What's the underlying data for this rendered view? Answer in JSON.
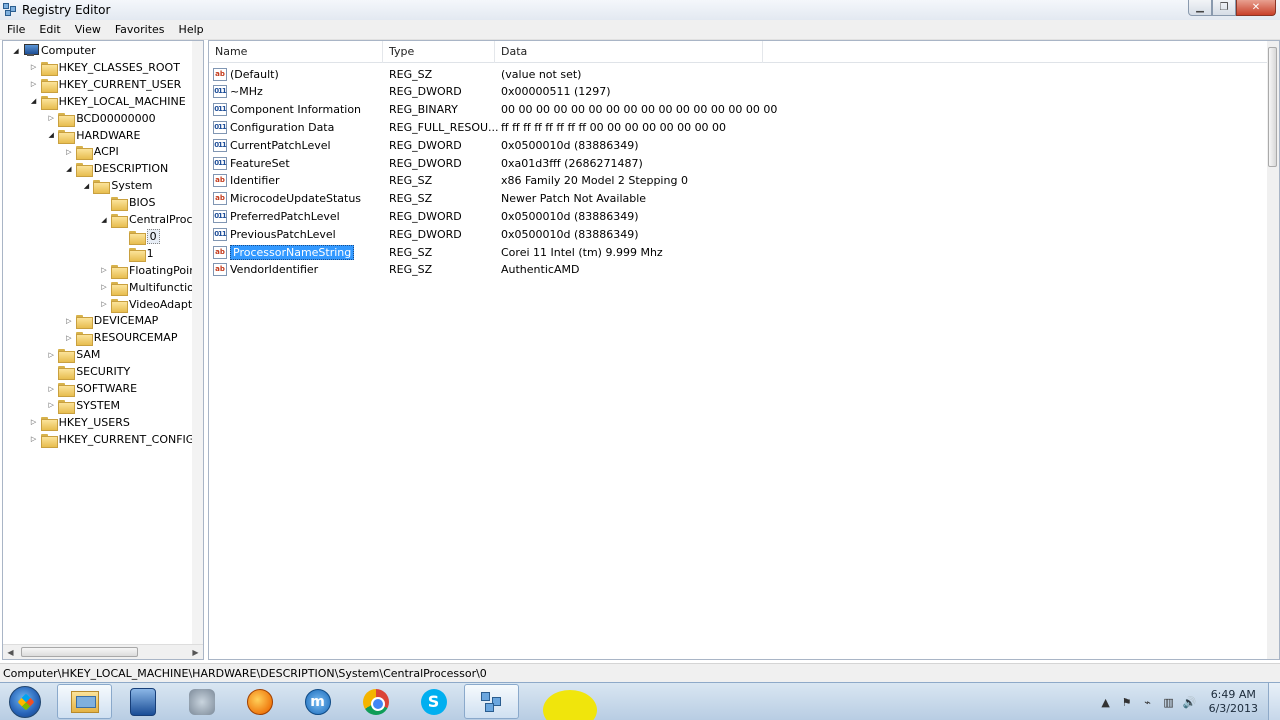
{
  "window": {
    "title": "Registry Editor"
  },
  "window_buttons": {
    "minimize": "▁",
    "maximize": "❐",
    "close": "✕"
  },
  "menu": [
    "File",
    "Edit",
    "View",
    "Favorites",
    "Help"
  ],
  "tree": [
    {
      "label": "Computer",
      "depth": 0,
      "expander": "open",
      "icon": "computer-icon"
    },
    {
      "label": "HKEY_CLASSES_ROOT",
      "depth": 1,
      "expander": "closed",
      "icon": "folder-icon"
    },
    {
      "label": "HKEY_CURRENT_USER",
      "depth": 1,
      "expander": "closed",
      "icon": "folder-icon"
    },
    {
      "label": "HKEY_LOCAL_MACHINE",
      "depth": 1,
      "expander": "open",
      "icon": "folder-icon"
    },
    {
      "label": "BCD00000000",
      "depth": 2,
      "expander": "closed",
      "icon": "folder-icon"
    },
    {
      "label": "HARDWARE",
      "depth": 2,
      "expander": "open",
      "icon": "folder-icon"
    },
    {
      "label": "ACPI",
      "depth": 3,
      "expander": "closed",
      "icon": "folder-icon"
    },
    {
      "label": "DESCRIPTION",
      "depth": 3,
      "expander": "open",
      "icon": "folder-icon"
    },
    {
      "label": "System",
      "depth": 4,
      "expander": "open",
      "icon": "folder-icon"
    },
    {
      "label": "BIOS",
      "depth": 5,
      "expander": "none",
      "icon": "folder-icon"
    },
    {
      "label": "CentralProces",
      "depth": 5,
      "expander": "open",
      "icon": "folder-icon"
    },
    {
      "label": "0",
      "depth": 6,
      "expander": "none",
      "icon": "folder-icon",
      "selected": true
    },
    {
      "label": "1",
      "depth": 6,
      "expander": "none",
      "icon": "folder-icon"
    },
    {
      "label": "FloatingPointI",
      "depth": 5,
      "expander": "closed",
      "icon": "folder-icon"
    },
    {
      "label": "Multifunction",
      "depth": 5,
      "expander": "closed",
      "icon": "folder-icon"
    },
    {
      "label": "VideoAdapterI",
      "depth": 5,
      "expander": "closed",
      "icon": "folder-icon"
    },
    {
      "label": "DEVICEMAP",
      "depth": 3,
      "expander": "closed",
      "icon": "folder-icon"
    },
    {
      "label": "RESOURCEMAP",
      "depth": 3,
      "expander": "closed",
      "icon": "folder-icon"
    },
    {
      "label": "SAM",
      "depth": 2,
      "expander": "closed",
      "icon": "folder-icon"
    },
    {
      "label": "SECURITY",
      "depth": 2,
      "expander": "none",
      "icon": "folder-icon"
    },
    {
      "label": "SOFTWARE",
      "depth": 2,
      "expander": "closed",
      "icon": "folder-icon"
    },
    {
      "label": "SYSTEM",
      "depth": 2,
      "expander": "closed",
      "icon": "folder-icon"
    },
    {
      "label": "HKEY_USERS",
      "depth": 1,
      "expander": "closed",
      "icon": "folder-icon"
    },
    {
      "label": "HKEY_CURRENT_CONFIG",
      "depth": 1,
      "expander": "closed",
      "icon": "folder-icon"
    }
  ],
  "tree_scroll": {
    "left_arrow": "◀",
    "right_arrow": "▶"
  },
  "columns": {
    "name": "Name",
    "type": "Type",
    "data": "Data"
  },
  "values": [
    {
      "name": "(Default)",
      "type": "REG_SZ",
      "data": "(value not set)",
      "icon": "string-value-icon"
    },
    {
      "name": "~MHz",
      "type": "REG_DWORD",
      "data": "0x00000511 (1297)",
      "icon": "binary-value-icon"
    },
    {
      "name": "Component Information",
      "type": "REG_BINARY",
      "data": "00 00 00 00 00 00 00 00 00 00 00 00 00 00 00 00",
      "icon": "binary-value-icon"
    },
    {
      "name": "Configuration Data",
      "type": "REG_FULL_RESOU...",
      "data": "ff ff ff ff ff ff ff ff 00 00 00 00 00 00 00 00",
      "icon": "binary-value-icon"
    },
    {
      "name": "CurrentPatchLevel",
      "type": "REG_DWORD",
      "data": "0x0500010d (83886349)",
      "icon": "binary-value-icon"
    },
    {
      "name": "FeatureSet",
      "type": "REG_DWORD",
      "data": "0xa01d3fff (2686271487)",
      "icon": "binary-value-icon"
    },
    {
      "name": "Identifier",
      "type": "REG_SZ",
      "data": "x86 Family 20 Model 2 Stepping 0",
      "icon": "string-value-icon"
    },
    {
      "name": "MicrocodeUpdateStatus",
      "type": "REG_SZ",
      "data": "Newer Patch Not Available",
      "icon": "string-value-icon"
    },
    {
      "name": "PreferredPatchLevel",
      "type": "REG_DWORD",
      "data": "0x0500010d (83886349)",
      "icon": "binary-value-icon"
    },
    {
      "name": "PreviousPatchLevel",
      "type": "REG_DWORD",
      "data": "0x0500010d (83886349)",
      "icon": "binary-value-icon"
    },
    {
      "name": "ProcessorNameString",
      "type": "REG_SZ",
      "data": "Corei 11 Intel (tm) 9.999 Mhz",
      "icon": "string-value-icon",
      "selected": true
    },
    {
      "name": "VendorIdentifier",
      "type": "REG_SZ",
      "data": "AuthenticAMD",
      "icon": "string-value-icon"
    }
  ],
  "value_icon_glyphs": {
    "string-value-icon": "ab",
    "binary-value-icon": "011"
  },
  "status": {
    "path": "Computer\\HKEY_LOCAL_MACHINE\\HARDWARE\\DESCRIPTION\\System\\CentralProcessor\\0"
  },
  "taskbar": {
    "apps": [
      {
        "name": "explorer-icon",
        "active": true
      },
      {
        "name": "media-player-icon",
        "active": false
      },
      {
        "name": "tools-icon",
        "active": false
      },
      {
        "name": "firefox-icon",
        "active": false
      },
      {
        "name": "maxthon-icon",
        "active": false,
        "glyph": "m"
      },
      {
        "name": "chrome-icon",
        "active": false
      },
      {
        "name": "skype-icon",
        "active": false,
        "glyph": "S"
      },
      {
        "name": "regedit-icon",
        "active": true
      }
    ],
    "tray_icons": [
      {
        "name": "show-hidden-icons-icon",
        "glyph": "▲"
      },
      {
        "name": "flag-icon",
        "glyph": "⚑"
      },
      {
        "name": "power-icon",
        "glyph": "⌁"
      },
      {
        "name": "network-icon",
        "glyph": "▥"
      },
      {
        "name": "volume-icon",
        "glyph": "🔊"
      }
    ],
    "clock": {
      "time": "6:49 AM",
      "date": "6/3/2013"
    }
  }
}
